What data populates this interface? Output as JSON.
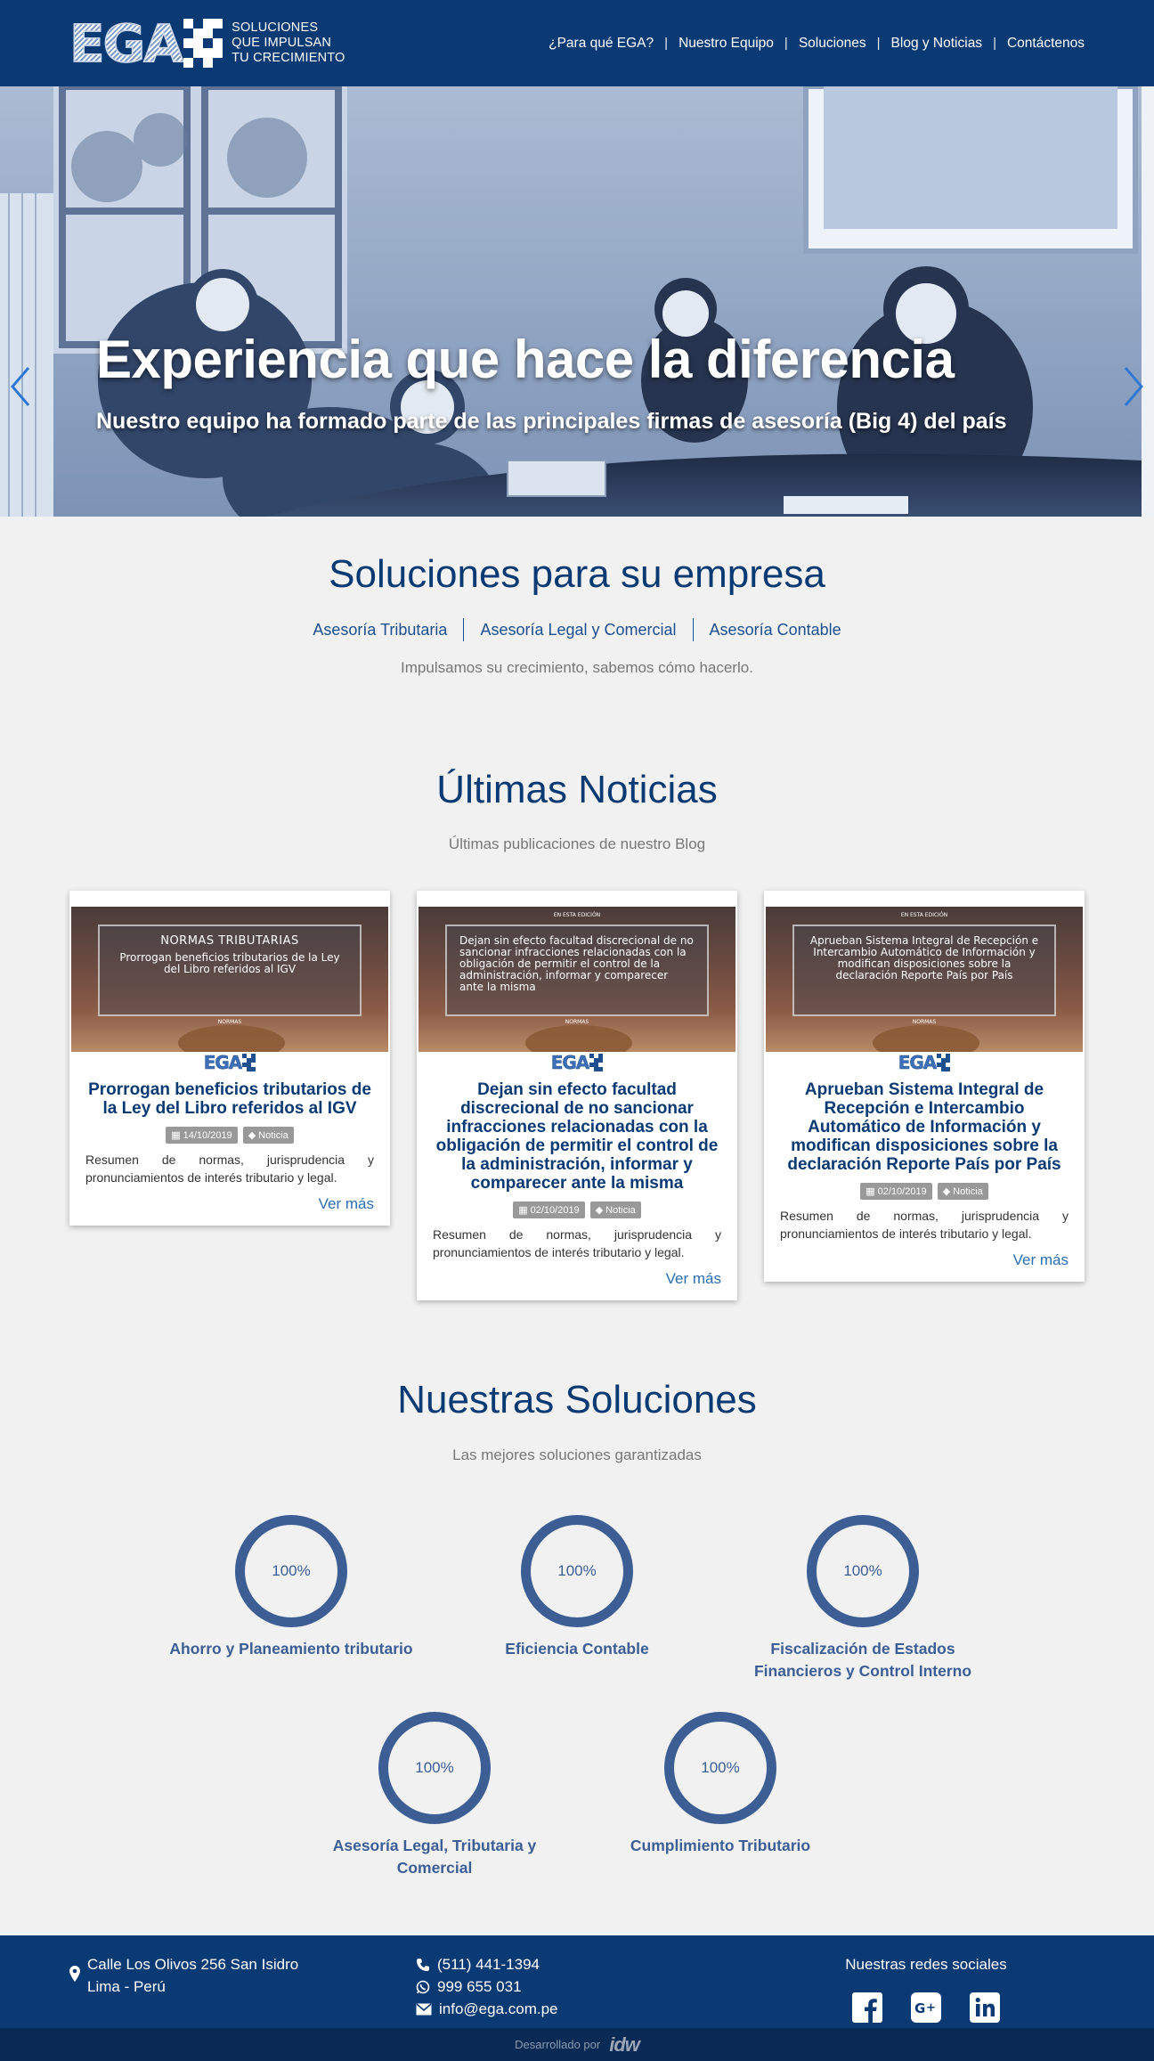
{
  "header": {
    "logo_text": "EGA",
    "tagline": [
      "SOLUCIONES",
      "QUE IMPULSAN",
      "TU CRECIMIENTO"
    ],
    "nav": [
      "¿Para qué EGA?",
      "Nuestro Equipo",
      "Soluciones",
      "Blog y Noticias",
      "Contáctenos"
    ]
  },
  "hero": {
    "title": "Experiencia que hace la diferencia",
    "subtitle": "Nuestro equipo ha formado parte de las principales firmas de asesoría (Big 4) del país"
  },
  "solutions_intro": {
    "title": "Soluciones para su empresa",
    "links": [
      "Asesoría Tributaria",
      "Asesoría Legal y Comercial",
      "Asesoría Contable"
    ],
    "tagline": "Impulsamos su crecimiento, sabemos cómo hacerlo."
  },
  "news": {
    "title": "Últimas Noticias",
    "subtitle": "Últimas publicaciones de nuestro Blog",
    "cards": [
      {
        "image_kicker": "NORMAS TRIBUTARIAS",
        "image_text": "Prorrogan beneficios tributarios de la Ley del Libro referidos al IGV",
        "image_bottom": "NORMAS",
        "title": "Prorrogan beneficios tributarios de la Ley del Libro referidos al IGV",
        "date": "14/10/2019",
        "tag": "Noticia",
        "summary": "Resumen de normas, jurisprudencia y pronunciamientos de interés tributario y legal.",
        "more": "Ver más"
      },
      {
        "image_top": "EN ESTA EDICIÓN",
        "image_text": "Dejan sin efecto facultad discrecional de no sancionar infracciones relacionadas con la obligación de permitir el control de la administración, informar y comparecer ante la misma",
        "image_bottom": "NORMAS",
        "title": "Dejan sin efecto facultad discrecional de no sancionar infracciones relacionadas con la obligación de permitir el control de la administración, informar y comparecer ante la misma",
        "date": "02/10/2019",
        "tag": "Noticia",
        "summary": "Resumen de normas, jurisprudencia y pronunciamientos de interés tributario y legal.",
        "more": "Ver más"
      },
      {
        "image_top": "EN ESTA EDICIÓN",
        "image_text": "Aprueban Sistema Integral de Recepción e Intercambio Automático de Información y modifican disposiciones sobre la declaración Reporte País por País",
        "image_bottom": "NORMAS",
        "title": "Aprueban Sistema Integral de Recepción e Intercambio Automático de Información y modifican disposiciones sobre la declaración Reporte País por País",
        "date": "02/10/2019",
        "tag": "Noticia",
        "summary": "Resumen de normas, jurisprudencia y pronunciamientos de interés tributario y legal.",
        "more": "Ver más"
      }
    ]
  },
  "our_solutions": {
    "title": "Nuestras Soluciones",
    "subtitle": "Las mejores soluciones garantizadas",
    "items": [
      {
        "percent": "100%",
        "label": "Ahorro y Planeamiento tributario"
      },
      {
        "percent": "100%",
        "label": "Eficiencia Contable"
      },
      {
        "percent": "100%",
        "label": "Fiscalización de Estados Financieros y Control Interno"
      },
      {
        "percent": "100%",
        "label": "Asesoría Legal, Tributaria y Comercial"
      },
      {
        "percent": "100%",
        "label": "Cumplimiento Tributario"
      }
    ]
  },
  "footer": {
    "address_line1": "Calle Los Olivos 256 San Isidro",
    "address_line2": "Lima - Perú",
    "phone": "(511) 441-1394",
    "whatsapp": "999 655 031",
    "email": "info@ega.com.pe",
    "social_title": "Nuestras redes sociales",
    "developed_by": "Desarrollado por",
    "developer": "idw"
  },
  "colors": {
    "brand": "#0a3a73",
    "accent": "#3c5e95",
    "link": "#2a6db1"
  }
}
